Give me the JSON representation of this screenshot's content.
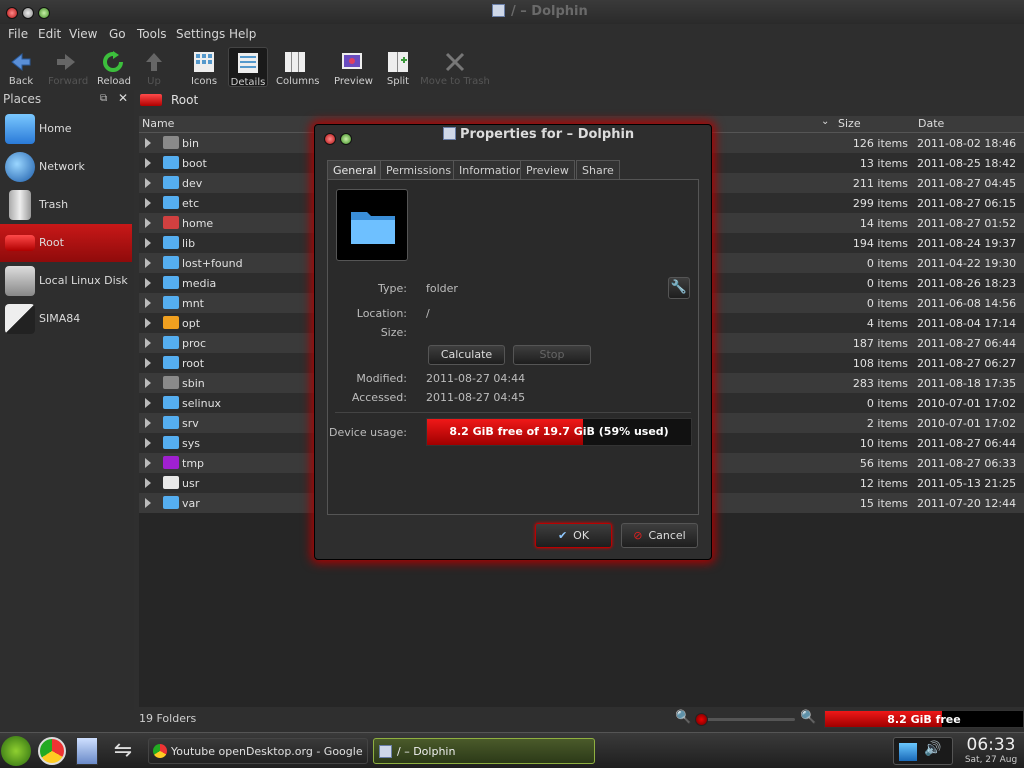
{
  "window": {
    "title": "/ – Dolphin"
  },
  "menu": [
    "File",
    "Edit",
    "View",
    "Go",
    "Tools",
    "Settings",
    "Help"
  ],
  "toolbar": {
    "back": "Back",
    "forward": "Forward",
    "reload": "Reload",
    "up": "Up",
    "icons": "Icons",
    "details": "Details",
    "columns": "Columns",
    "preview": "Preview",
    "split": "Split",
    "move_to_trash": "Move to Trash"
  },
  "places": {
    "title": "Places",
    "items": [
      {
        "label": "Home",
        "icon": "home-icon"
      },
      {
        "label": "Network",
        "icon": "network-icon"
      },
      {
        "label": "Trash",
        "icon": "trash-icon"
      },
      {
        "label": "Root",
        "icon": "root-icon"
      },
      {
        "label": "Local Linux Disk",
        "icon": "disk-icon"
      },
      {
        "label": "SIMA84",
        "icon": "usb-icon"
      }
    ]
  },
  "breadcrumb": {
    "label": "Root"
  },
  "columns": {
    "name": "Name",
    "size": "Size",
    "date": "Date"
  },
  "files": [
    {
      "name": "bin",
      "size": "126 items",
      "date": "2011-08-02 18:46",
      "color": "#8a8a8a"
    },
    {
      "name": "boot",
      "size": "13 items",
      "date": "2011-08-25 18:42",
      "color": "#55aef0"
    },
    {
      "name": "dev",
      "size": "211 items",
      "date": "2011-08-27 04:45",
      "color": "#55aef0"
    },
    {
      "name": "etc",
      "size": "299 items",
      "date": "2011-08-27 06:15",
      "color": "#55aef0"
    },
    {
      "name": "home",
      "size": "14 items",
      "date": "2011-08-27 01:52",
      "color": "#d04040"
    },
    {
      "name": "lib",
      "size": "194 items",
      "date": "2011-08-24 19:37",
      "color": "#55aef0"
    },
    {
      "name": "lost+found",
      "size": "0 items",
      "date": "2011-04-22 19:30",
      "color": "#55aef0"
    },
    {
      "name": "media",
      "size": "0 items",
      "date": "2011-08-26 18:23",
      "color": "#55aef0"
    },
    {
      "name": "mnt",
      "size": "0 items",
      "date": "2011-06-08 14:56",
      "color": "#55aef0"
    },
    {
      "name": "opt",
      "size": "4 items",
      "date": "2011-08-04 17:14",
      "color": "#f0a020"
    },
    {
      "name": "proc",
      "size": "187 items",
      "date": "2011-08-27 06:44",
      "color": "#55aef0"
    },
    {
      "name": "root",
      "size": "108 items",
      "date": "2011-08-27 06:27",
      "color": "#55aef0"
    },
    {
      "name": "sbin",
      "size": "283 items",
      "date": "2011-08-18 17:35",
      "color": "#8a8a8a"
    },
    {
      "name": "selinux",
      "size": "0 items",
      "date": "2010-07-01 17:02",
      "color": "#55aef0"
    },
    {
      "name": "srv",
      "size": "2 items",
      "date": "2010-07-01 17:02",
      "color": "#55aef0"
    },
    {
      "name": "sys",
      "size": "10 items",
      "date": "2011-08-27 06:44",
      "color": "#55aef0"
    },
    {
      "name": "tmp",
      "size": "56 items",
      "date": "2011-08-27 06:33",
      "color": "#a020d0"
    },
    {
      "name": "usr",
      "size": "12 items",
      "date": "2011-05-13 21:25",
      "color": "#e8e8e8"
    },
    {
      "name": "var",
      "size": "15 items",
      "date": "2011-07-20 12:44",
      "color": "#55aef0"
    }
  ],
  "status": {
    "text": "19 Folders",
    "free_space": "8.2 GiB free",
    "free_fraction": 0.59
  },
  "dialog": {
    "title": "Properties for  – Dolphin",
    "tabs": [
      "General",
      "Permissions",
      "Information",
      "Preview",
      "Share"
    ],
    "type_label": "Type:",
    "type_value": "folder",
    "location_label": "Location:",
    "location_value": "/",
    "size_label": "Size:",
    "calculate": "Calculate",
    "stop": "Stop",
    "modified_label": "Modified:",
    "modified_value": "2011-08-27 04:44",
    "accessed_label": "Accessed:",
    "accessed_value": "2011-08-27 04:45",
    "usage_label": "Device usage:",
    "usage_text": "8.2 GiB free of 19.7 GiB (59% used)",
    "usage_fraction": 0.59,
    "ok": "OK",
    "cancel": "Cancel"
  },
  "taskbar": {
    "task1": "Youtube openDesktop.org - Google Chro",
    "task2": "/ – Dolphin",
    "clock_time": "06:33",
    "clock_date": "Sat, 27 Aug"
  },
  "colors": {
    "accent": "#c81818",
    "folder": "#55aef0"
  }
}
